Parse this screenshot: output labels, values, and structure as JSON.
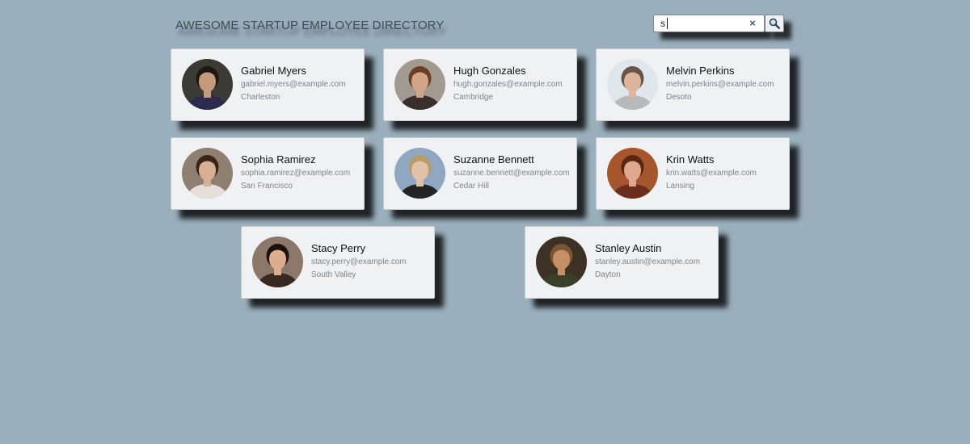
{
  "header": {
    "title": "AWESOME STARTUP EMPLOYEE DIRECTORY"
  },
  "search": {
    "value": "s",
    "clear_label": "×"
  },
  "employees": [
    {
      "name": "Gabriel Myers",
      "email": "gabriel.myers@example.com",
      "city": "Charleston",
      "photo": {
        "bg": "#3b3a34",
        "skin": "#c39a7c",
        "hair": "#1f1712",
        "shirt": "#2e2a4d"
      }
    },
    {
      "name": "Hugh Gonzales",
      "email": "hugh.gonzales@example.com",
      "city": "Cambridge",
      "photo": {
        "bg": "#a29a90",
        "skin": "#d2a588",
        "hair": "#6b3e24",
        "shirt": "#3a2e2c"
      }
    },
    {
      "name": "Melvin Perkins",
      "email": "melvin.perkins@example.com",
      "city": "Desoto",
      "photo": {
        "bg": "#dfe6ec",
        "skin": "#dcb59c",
        "hair": "#6a5447",
        "shirt": "#b7b9bc"
      }
    },
    {
      "name": "Sophia Ramirez",
      "email": "sophia.ramirez@example.com",
      "city": "San Francisco",
      "photo": {
        "bg": "#8e7f70",
        "skin": "#d8b096",
        "hair": "#3a2418",
        "shirt": "#e4dfda"
      }
    },
    {
      "name": "Suzanne Bennett",
      "email": "suzanne.bennett@example.com",
      "city": "Cedar Hill",
      "photo": {
        "bg": "#8fa7c0",
        "skin": "#e2c1a9",
        "hair": "#b89a6c",
        "shirt": "#242424"
      }
    },
    {
      "name": "Krin Watts",
      "email": "krin.watts@example.com",
      "city": "Lansing",
      "photo": {
        "bg": "#a5562c",
        "skin": "#e0a88f",
        "hair": "#5a2614",
        "shirt": "#6b2d1d"
      }
    },
    {
      "name": "Stacy Perry",
      "email": "stacy.perry@example.com",
      "city": "South Valley",
      "photo": {
        "bg": "#8c7868",
        "skin": "#dcae8f",
        "hair": "#1c110d",
        "shirt": "#3a2922"
      }
    },
    {
      "name": "Stanley Austin",
      "email": "stanley.austin@example.com",
      "city": "Dayton",
      "photo": {
        "bg": "#3c3124",
        "skin": "#c49066",
        "hair": "#7a5533",
        "shirt": "#3b3f2a"
      }
    }
  ]
}
